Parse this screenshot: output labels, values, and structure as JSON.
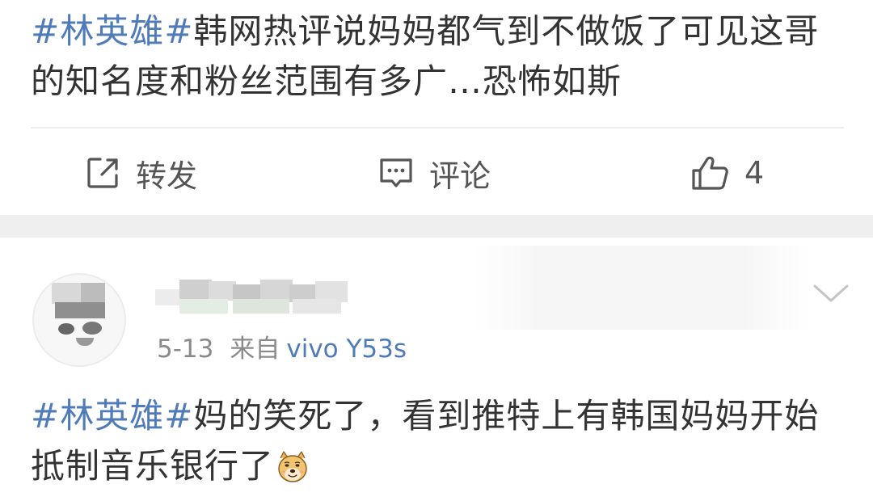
{
  "post1": {
    "hashtag": "#林英雄#",
    "text": "韩网热评说妈妈都气到不做饭了可见这哥的知名度和粉丝范围有多广…恐怖如斯"
  },
  "actions": {
    "forward_label": "转发",
    "comment_label": "评论",
    "like_count": "4",
    "forward_icon": "share-square-icon",
    "comment_icon": "comment-bubble-icon",
    "like_icon": "thumbs-up-icon"
  },
  "post2": {
    "date": "5-13",
    "source_label": "来自",
    "device": "vivo Y53s",
    "hashtag": "#林英雄#",
    "text": "妈的笑死了，看到推特上有韩国妈妈开始抵制音乐银行了",
    "emoji": "doge-emoji-icon",
    "more_icon": "chevron-down-icon"
  },
  "colors": {
    "link": "#4f7bb8",
    "text": "#333333",
    "meta": "#8a8a8a",
    "separator": "#efefef"
  }
}
